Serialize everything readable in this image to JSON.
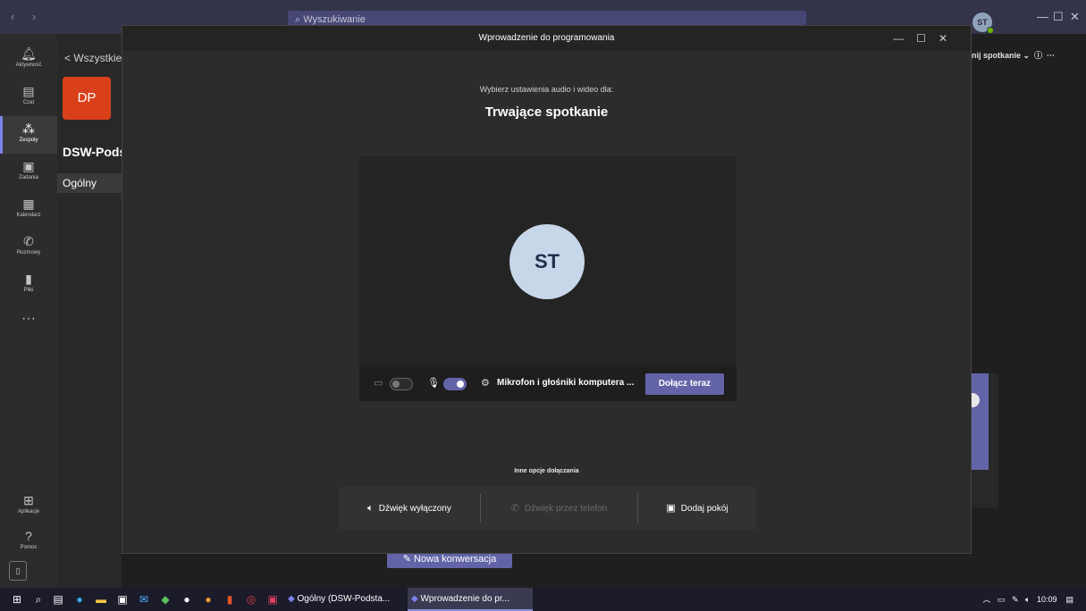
{
  "background": {
    "search_placeholder": "Wyszukiwanie",
    "back_link": "< Wszystkie",
    "team_initials": "DP",
    "team_name": "DSW-Pods",
    "channel": "Ogólny",
    "user_initials": "ST",
    "right_toolbar": "nij spotkanie",
    "new_conversation": "Nowa konwersacja",
    "rail": [
      {
        "label": "Aktywność",
        "icon": "bell-icon"
      },
      {
        "label": "Czat",
        "icon": "chat-icon"
      },
      {
        "label": "Zespoły",
        "icon": "teams-icon"
      },
      {
        "label": "Zadania",
        "icon": "tasks-icon"
      },
      {
        "label": "Kalendarz",
        "icon": "calendar-icon"
      },
      {
        "label": "Rozmowy",
        "icon": "phone-icon"
      },
      {
        "label": "Pliki",
        "icon": "files-icon"
      },
      {
        "label": "Aplikacje",
        "icon": "apps-icon"
      },
      {
        "label": "Pomoc",
        "icon": "help-icon"
      }
    ]
  },
  "modal": {
    "title": "Wprowadzenie do programowania",
    "subtitle": "Wybierz ustawienia audio i wideo dla:",
    "heading": "Trwające spotkanie",
    "avatar_initials": "ST",
    "device_label": "Mikrofon i głośniki komputera ...",
    "join_button": "Dołącz teraz",
    "camera_on": false,
    "mic_on": true,
    "other_options_label": "Inne opcje dołączania",
    "options": [
      {
        "label": "Dźwięk wyłączony",
        "icon": "speaker-muted-icon",
        "enabled": true
      },
      {
        "label": "Dźwięk przez telefon",
        "icon": "phone-icon",
        "enabled": false
      },
      {
        "label": "Dodaj pokój",
        "icon": "room-icon",
        "enabled": true
      }
    ]
  },
  "taskbar": {
    "apps": [
      {
        "label": "Ogólny (DSW-Podsta...",
        "active": false
      },
      {
        "label": "Wprowadzenie do pr...",
        "active": true
      }
    ],
    "time": "10:09"
  },
  "colors": {
    "accent": "#6264a7",
    "team_tile": "#d9401a",
    "presence": "#6bb700"
  }
}
